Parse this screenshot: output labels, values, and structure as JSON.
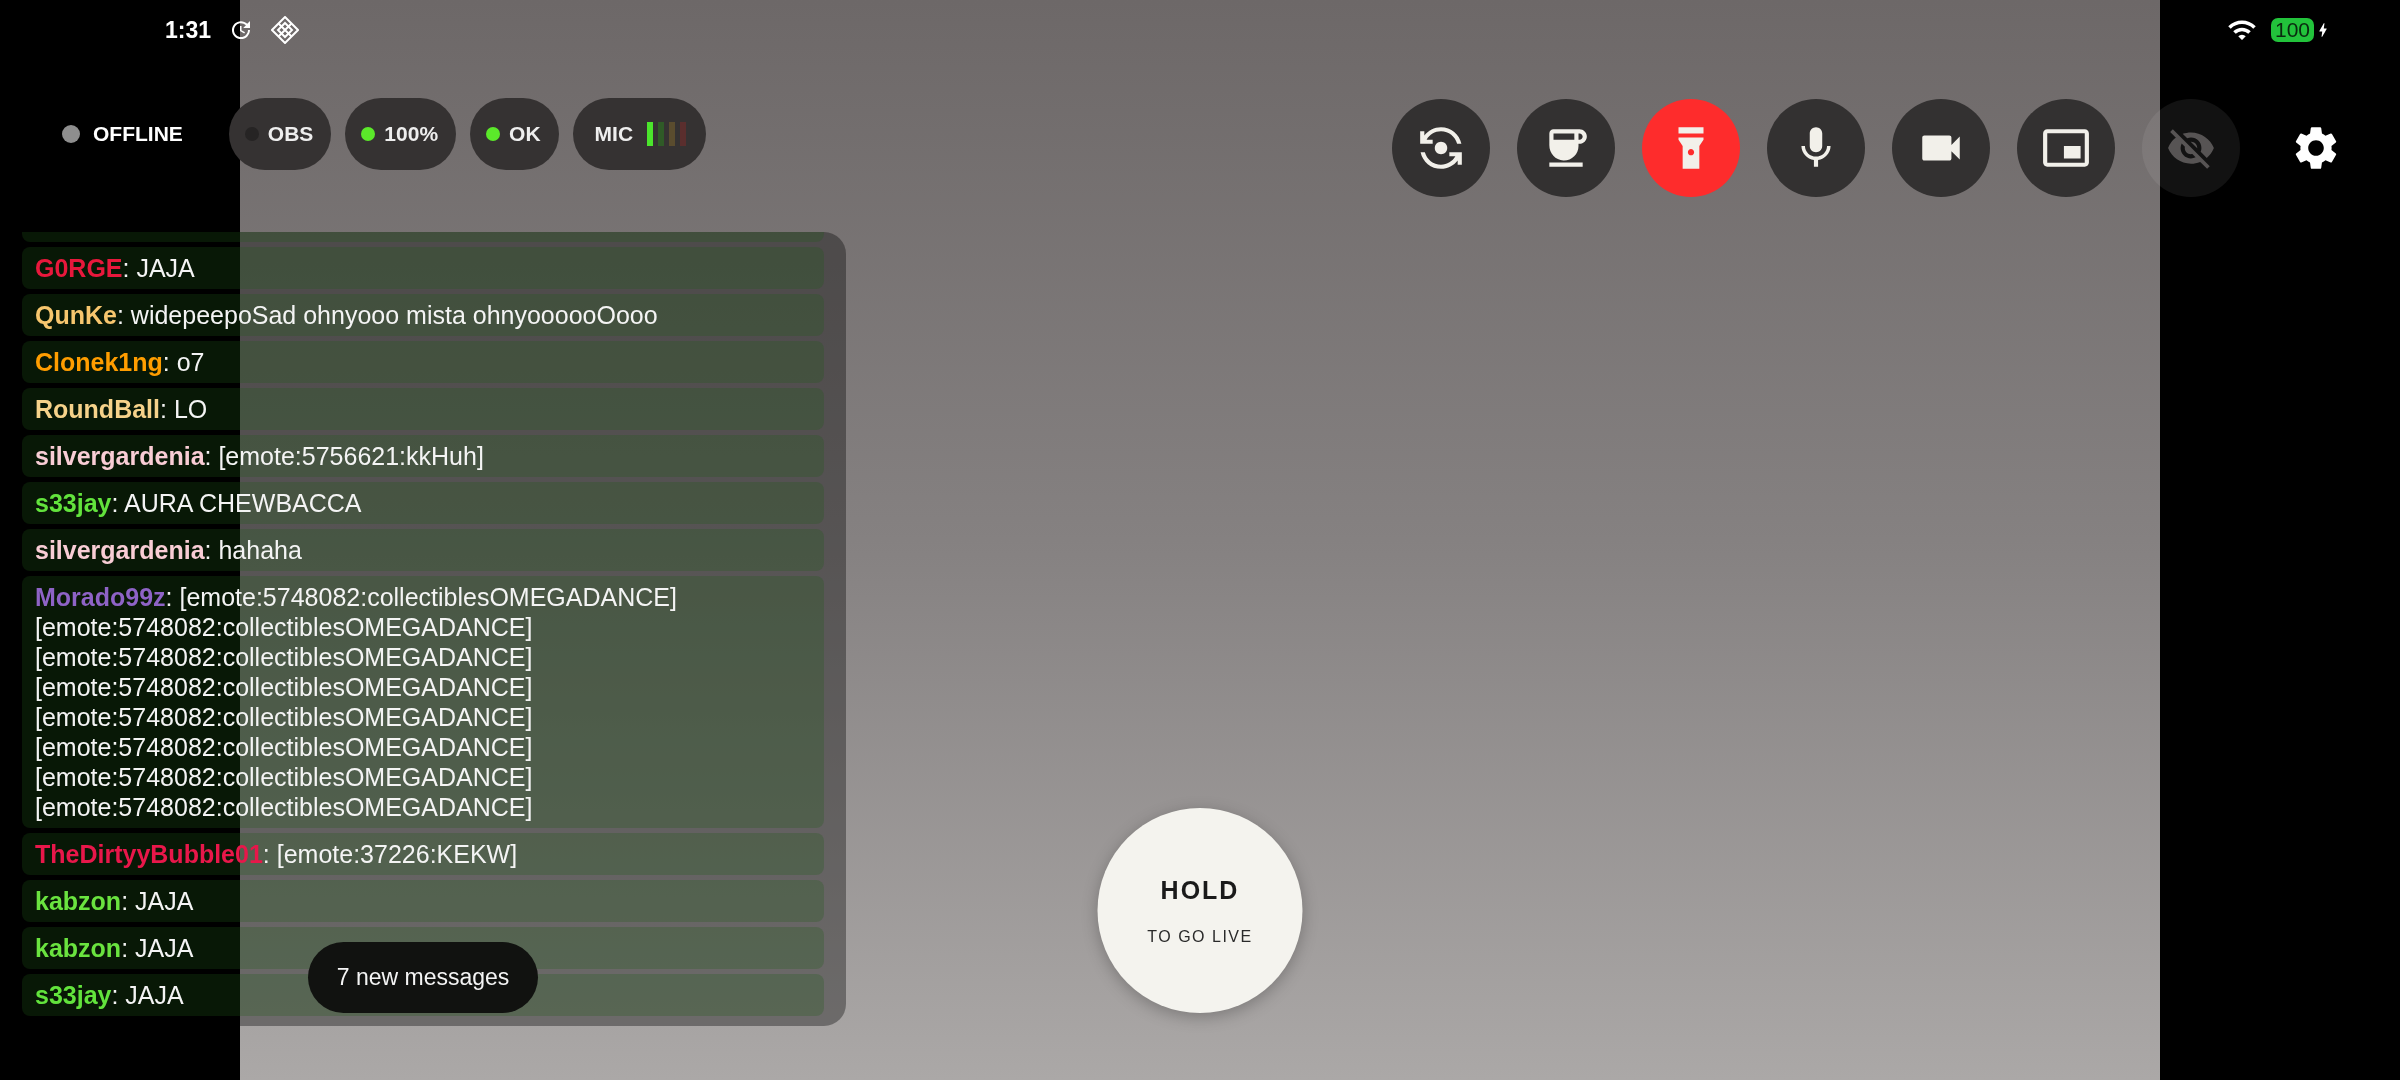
{
  "status_bar": {
    "time": "1:31",
    "battery": "100",
    "charging": true
  },
  "stream_status": {
    "label": "OFFLINE",
    "live": false
  },
  "indicators": [
    {
      "kind": "status",
      "label": "OBS",
      "active": false
    },
    {
      "kind": "status",
      "label": "100%",
      "active": true
    },
    {
      "kind": "status",
      "label": "OK",
      "active": true
    },
    {
      "kind": "meter",
      "label": "MIC",
      "level": 0.25
    }
  ],
  "controls": [
    {
      "active": false,
      "disabled": false
    },
    {
      "active": false,
      "disabled": false
    },
    {
      "active": true,
      "disabled": false
    },
    {
      "active": false,
      "disabled": false
    },
    {
      "active": false,
      "disabled": false
    },
    {
      "active": false,
      "disabled": false
    },
    {
      "active": false,
      "disabled": true
    }
  ],
  "chat": {
    "messages": [
      {
        "user": "G0RGE",
        "color": "#e8183c",
        "text": ": JAJA"
      },
      {
        "user": "QunKe",
        "color": "#f7c66e",
        "text": ": widepeepoSad ohnyooo mista ohnyoooooOooo"
      },
      {
        "user": "Clonek1ng",
        "color": "#ff9d00",
        "text": ": o7"
      },
      {
        "user": "RoundBall",
        "color": "#f6d28a",
        "text": ": LO"
      },
      {
        "user": "silvergardenia",
        "color": "#f9cdd5",
        "text": ": [emote:5756621:kkHuh]"
      },
      {
        "user": "s33jay",
        "color": "#62e33c",
        "text": ": AURA CHEWBACCA"
      },
      {
        "user": "silvergardenia",
        "color": "#f9cdd5",
        "text": ": hahaha"
      },
      {
        "user": "Morado99z",
        "color": "#8e63c6",
        "text": ": [emote:5748082:collectiblesOMEGADANCE] [emote:5748082:collectiblesOMEGADANCE] [emote:5748082:collectiblesOMEGADANCE] [emote:5748082:collectiblesOMEGADANCE] [emote:5748082:collectiblesOMEGADANCE] [emote:5748082:collectiblesOMEGADANCE] [emote:5748082:collectiblesOMEGADANCE] [emote:5748082:collectiblesOMEGADANCE]"
      },
      {
        "user": "TheDirtyyBubble01",
        "color": "#e8174a",
        "text": ": [emote:37226:KEKW]"
      },
      {
        "user": "kabzon",
        "color": "#6ae33f",
        "text": ": JAJA"
      },
      {
        "user": "kabzon",
        "color": "#6ae33f",
        "text": ": JAJA"
      },
      {
        "user": "s33jay",
        "color": "#62e33c",
        "text": ": JAJA"
      }
    ],
    "new_messages": "7 new messages"
  },
  "go_live": {
    "title": "HOLD",
    "subtitle": "TO GO LIVE"
  }
}
